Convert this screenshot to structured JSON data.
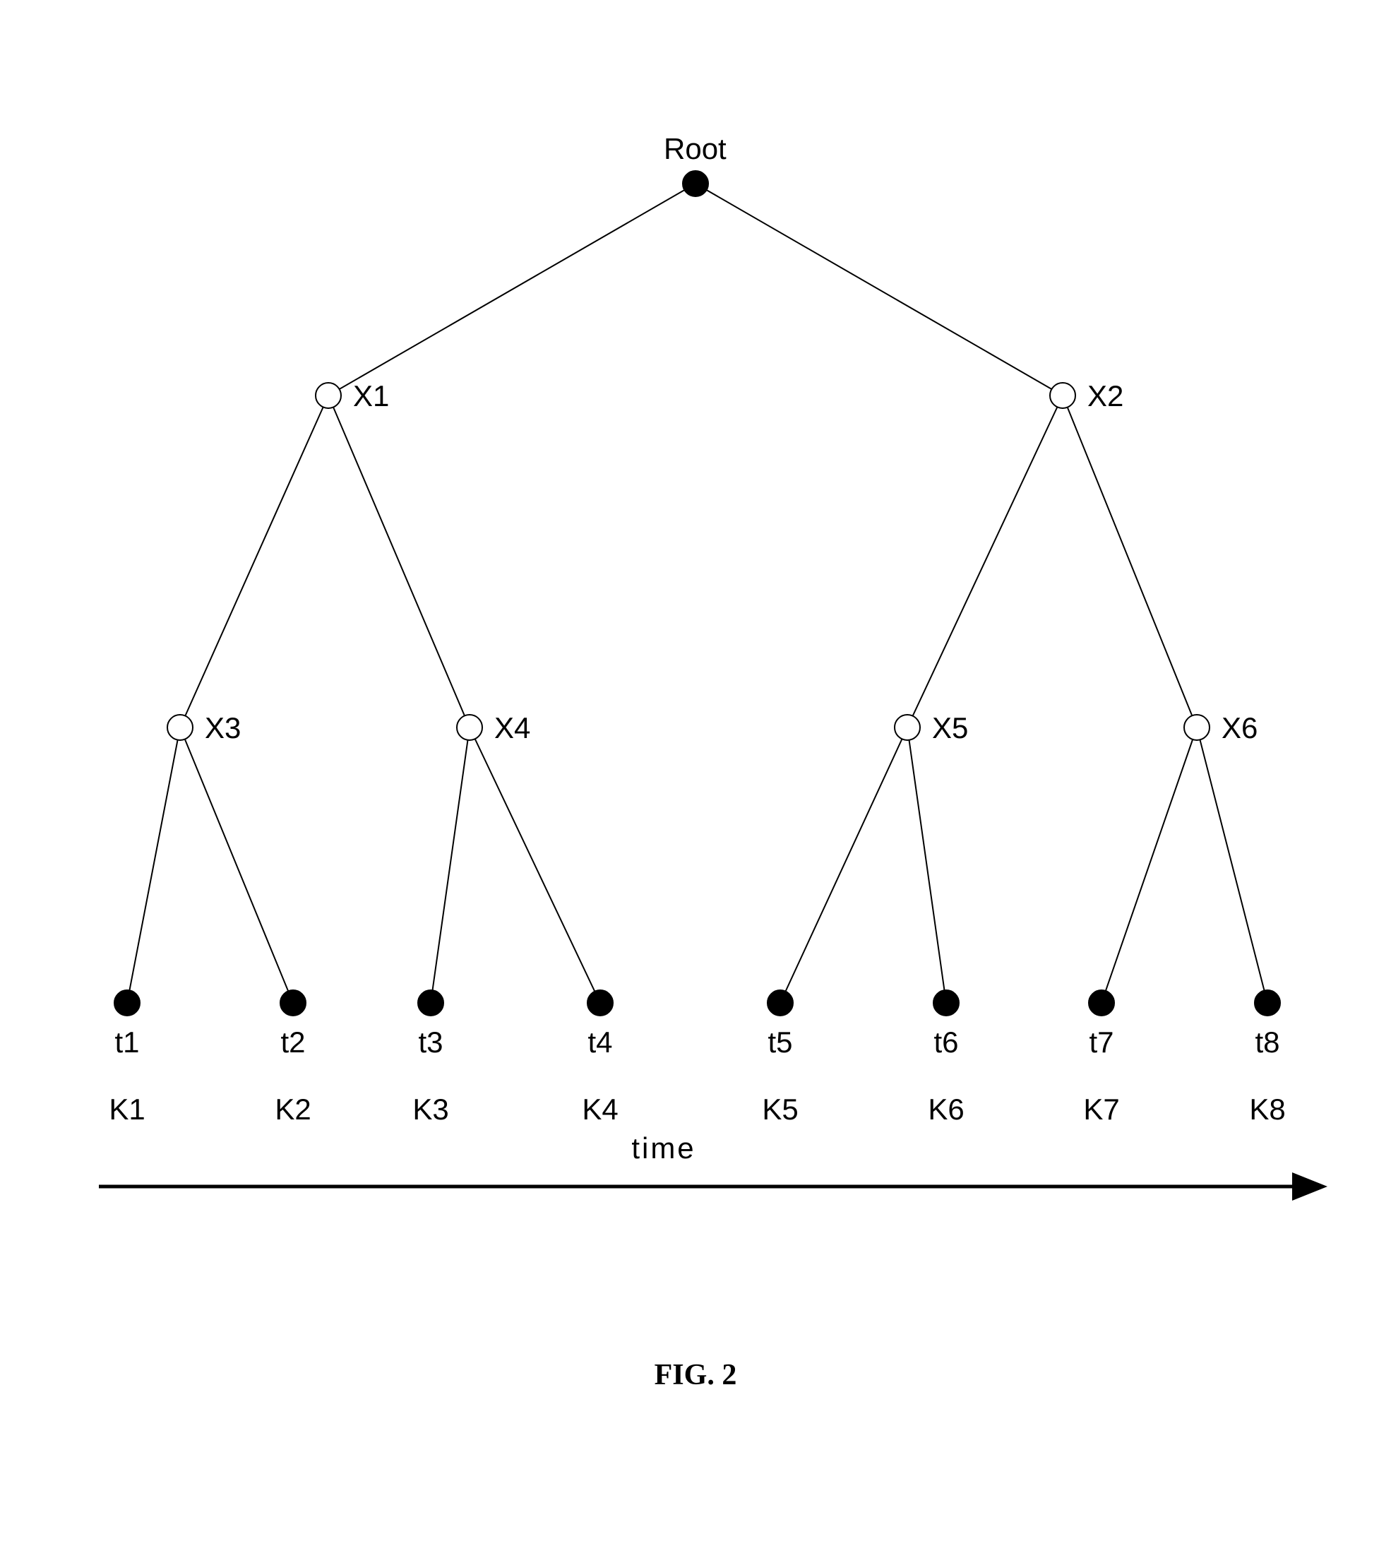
{
  "diagram": {
    "root_label": "Root",
    "internal_nodes": {
      "x1": "X1",
      "x2": "X2",
      "x3": "X3",
      "x4": "X4",
      "x5": "X5",
      "x6": "X6"
    },
    "leaves": {
      "t1": "t1",
      "t2": "t2",
      "t3": "t3",
      "t4": "t4",
      "t5": "t5",
      "t6": "t6",
      "t7": "t7",
      "t8": "t8"
    },
    "keys": {
      "k1": "K1",
      "k2": "K2",
      "k3": "K3",
      "k4": "K4",
      "k5": "K5",
      "k6": "K6",
      "k7": "K7",
      "k8": "K8"
    },
    "axis_label": "time",
    "caption": "FIG. 2"
  }
}
